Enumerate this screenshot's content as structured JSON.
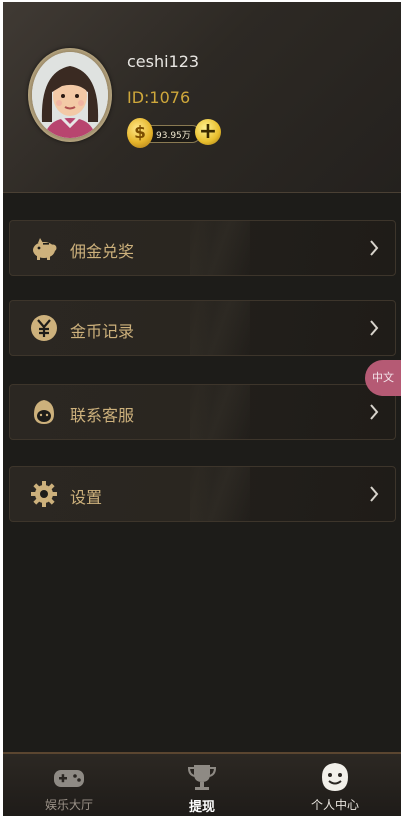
{
  "profile": {
    "username": "ceshi123",
    "id_label": "ID:1076",
    "coins": "93.95万",
    "coin_symbol": "$",
    "plus_symbol": "+"
  },
  "menu": [
    {
      "label": "佣金兑奖",
      "icon": "piggy-bank-icon"
    },
    {
      "label": "金币记录",
      "icon": "yen-coin-icon"
    },
    {
      "label": "联系客服",
      "icon": "customer-service-icon"
    },
    {
      "label": "设置",
      "icon": "gear-icon"
    }
  ],
  "translate_badge": "中文",
  "bottom_nav": [
    {
      "label": "娱乐大厅",
      "icon": "gamepad-icon"
    },
    {
      "label": "提现",
      "icon": "trophy-icon"
    },
    {
      "label": "个人中心",
      "icon": "smiley-face-icon"
    }
  ],
  "colors": {
    "accent_gold": "#cfa83b",
    "menu_text": "#cdb17c",
    "background": "#1d1c19"
  }
}
